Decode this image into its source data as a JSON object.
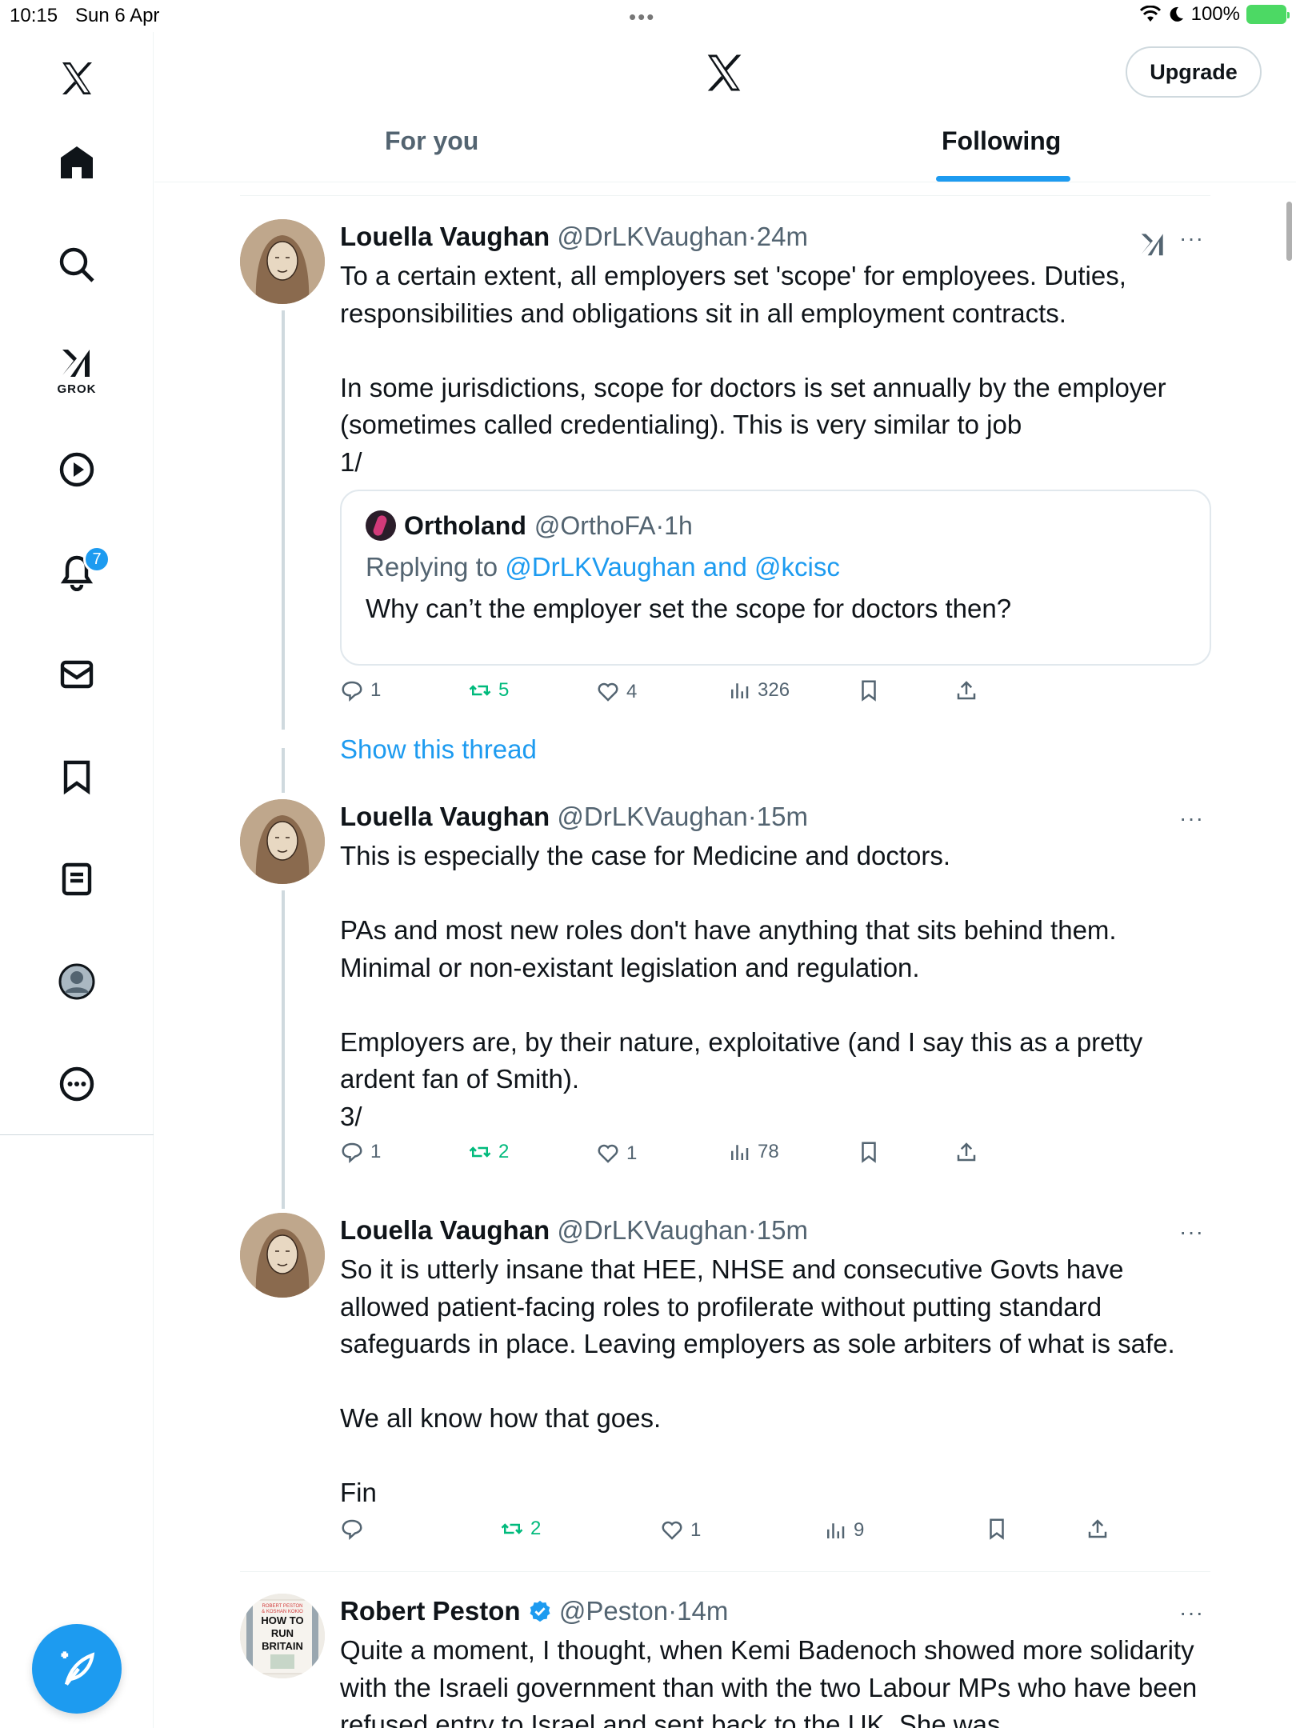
{
  "status_bar": {
    "time": "10:15",
    "date": "Sun 6 Apr",
    "battery": "100%"
  },
  "sidebar": {
    "grok_label": "GROK",
    "notification_count": "7",
    "items": [
      "home",
      "explore",
      "grok",
      "video",
      "notifications",
      "messages",
      "bookmarks",
      "lists",
      "profile",
      "more"
    ]
  },
  "header": {
    "upgrade_label": "Upgrade",
    "tabs": [
      {
        "label": "For you",
        "active": false
      },
      {
        "label": "Following",
        "active": true
      }
    ]
  },
  "colors": {
    "accent": "#1d9bf0",
    "retweet": "#00ba7c",
    "muted": "#536471"
  },
  "tweets": [
    {
      "name": "Louella Vaughan",
      "handle": "@DrLKVaughan",
      "sep": "·",
      "time": "24m",
      "text": "To a certain extent, all employers set 'scope' for employees. Duties, responsibilities and obligations sit in all employment contracts.\n\nIn some jurisdictions, scope for doctors is set annually by the employer (sometimes called credentialing). This is very similar to job\n1/",
      "quote": {
        "name": "Ortholand",
        "handle": "@OrthoFA",
        "sep": "·",
        "time": "1h",
        "replying_prefix": "Replying to ",
        "replying_to": "@DrLKVaughan and @kcisc",
        "text": "Why can’t the employer set the scope for doctors then?"
      },
      "replies": "1",
      "retweets": "5",
      "likes": "4",
      "views": "326"
    },
    {
      "name": "Louella Vaughan",
      "handle": "@DrLKVaughan",
      "sep": "·",
      "time": "15m",
      "text": "This is especially the case for Medicine and doctors.\n\nPAs and most new roles don't have anything that sits behind them. Minimal or non-existant legislation and regulation.\n\nEmployers are, by their nature, exploitative (and I say this as a pretty ardent fan of Smith).\n3/",
      "replies": "1",
      "retweets": "2",
      "likes": "1",
      "views": "78"
    },
    {
      "name": "Louella Vaughan",
      "handle": "@DrLKVaughan",
      "sep": "·",
      "time": "15m",
      "text": "So it is utterly insane that HEE, NHSE and consecutive Govts have allowed patient-facing roles to profilerate without putting standard safeguards in place. Leaving employers as sole arbiters of what is safe.\n\nWe all know how that goes.\n\nFin",
      "replies": "",
      "retweets": "2",
      "likes": "1",
      "views": "9"
    },
    {
      "name": "Robert Peston",
      "handle": "@Peston",
      "sep": "·",
      "time": "14m",
      "verified": true,
      "avatar_text": [
        "ROBERT PESTON",
        "& KOSHAN KOKIO",
        "HOW TO",
        "RUN",
        "BRITAIN"
      ],
      "text": "Quite a moment, I thought, when Kemi Badenoch showed more solidarity with the Israeli government than with the two Labour MPs who have been refused entry to Israel and sent back to the UK. She was"
    }
  ],
  "show_thread_label": "Show this thread",
  "more_label": "···"
}
